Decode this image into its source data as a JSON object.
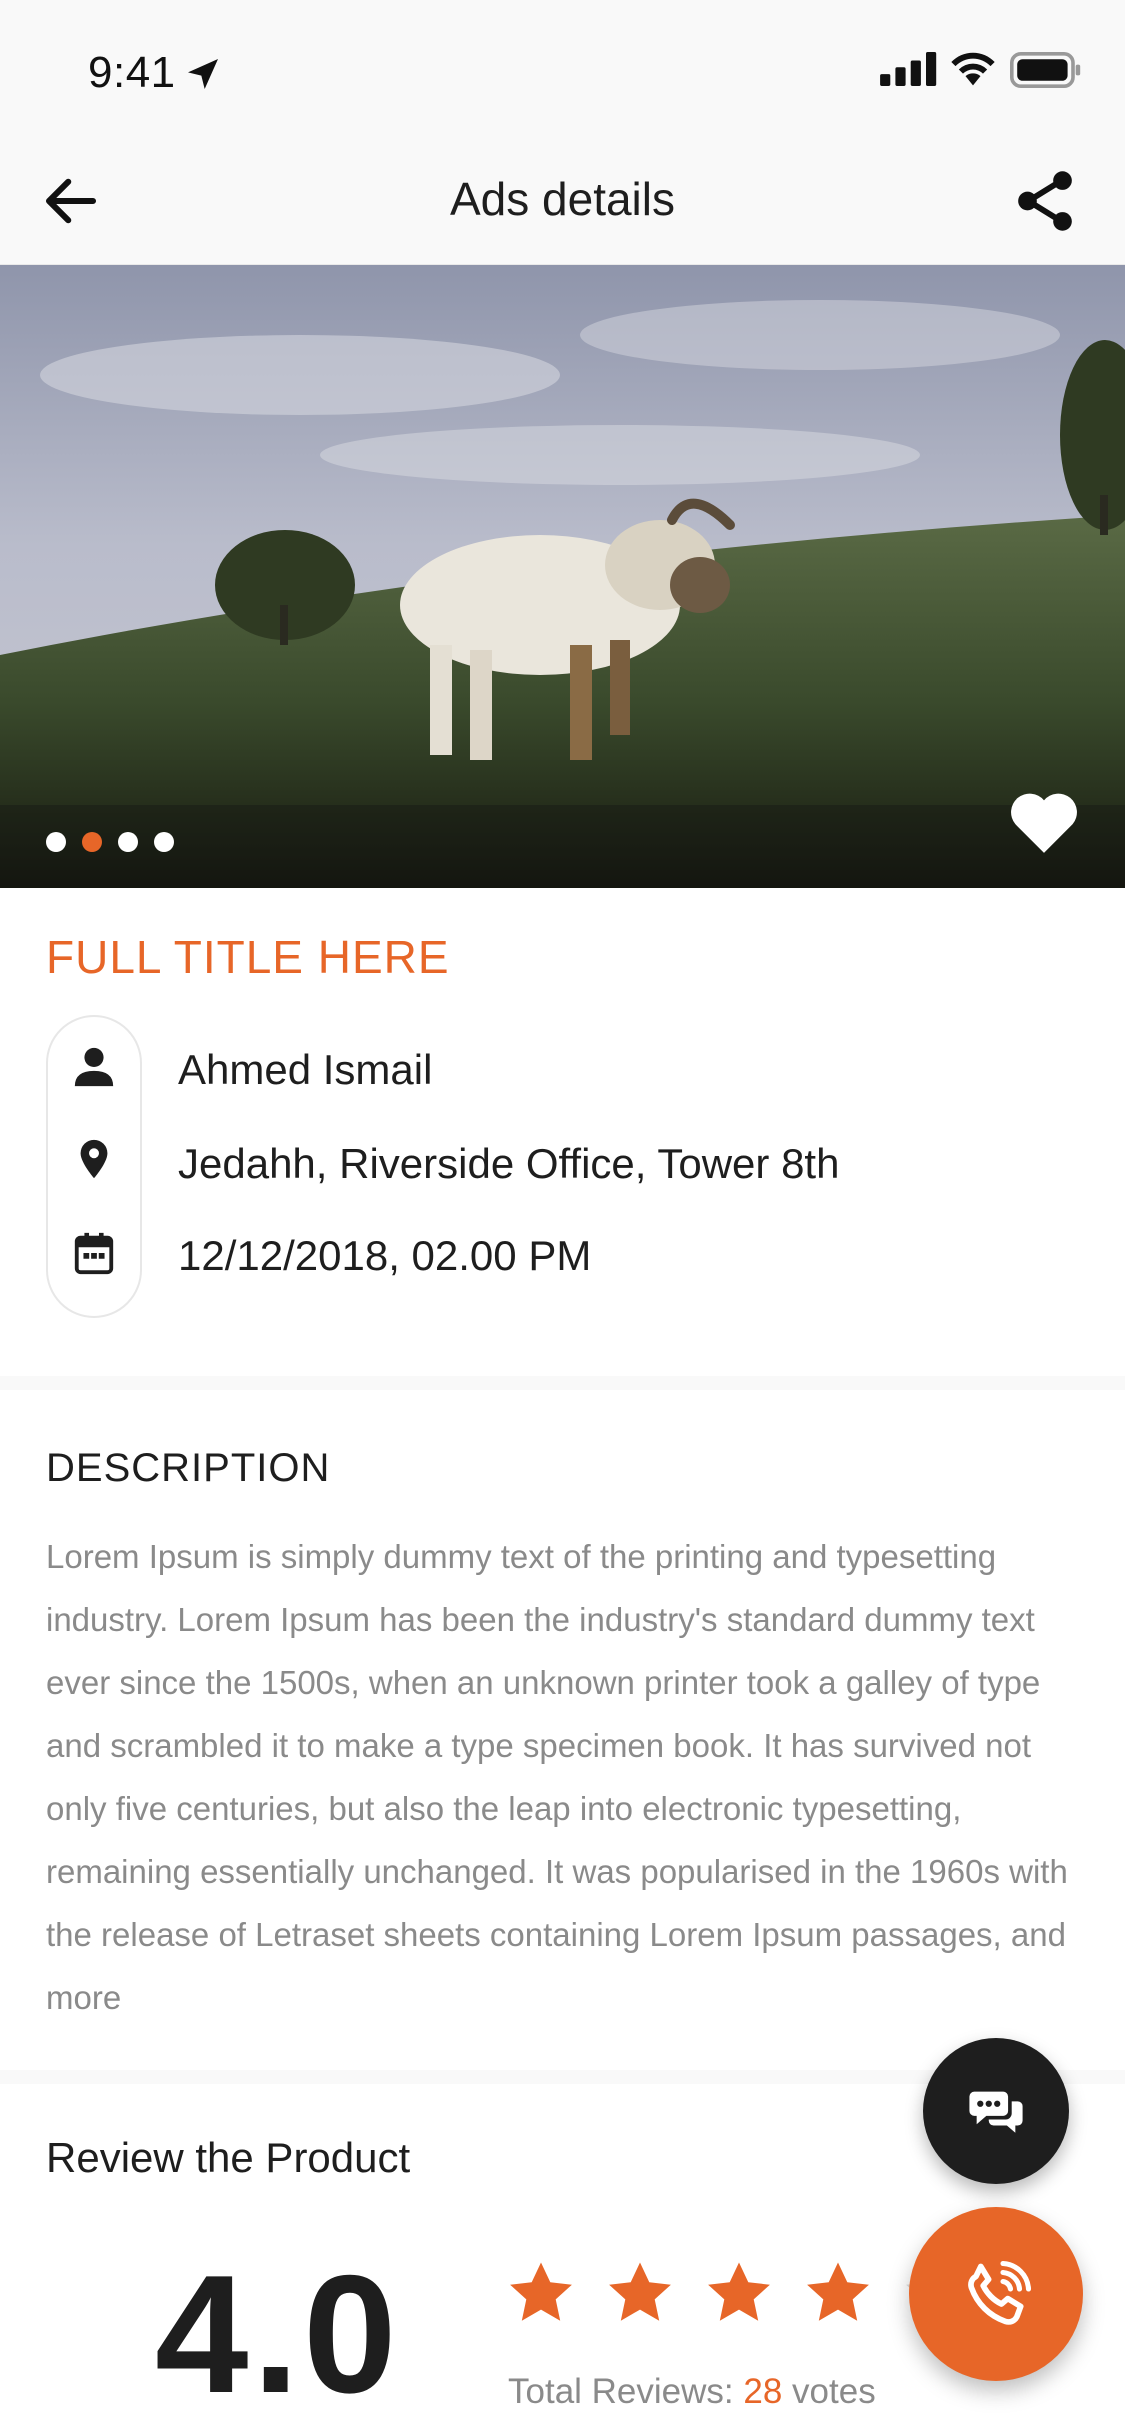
{
  "status_bar": {
    "time": "9:41"
  },
  "nav": {
    "title": "Ads details"
  },
  "gallery": {
    "image_count": 4,
    "active_index": 1
  },
  "ad": {
    "title": "FULL TITLE HERE",
    "seller": "Ahmed Ismail",
    "location": "Jedahh, Riverside Office, Tower 8th",
    "datetime": "12/12/2018, 02.00 PM"
  },
  "description": {
    "heading": "DESCRIPTION",
    "text": "Lorem Ipsum is simply dummy text of the printing and typesetting industry. Lorem Ipsum has been the industry's standard dummy text ever since the 1500s, when an unknown printer took a galley of type and scrambled it to make a type specimen book. It has survived not only five centuries, but also the leap into electronic typesetting, remaining essentially unchanged. It was popularised in the 1960s with the release of Letraset sheets containing Lorem Ipsum passages, and more"
  },
  "review": {
    "heading": "Review the Product",
    "rating": "4.0",
    "stars_filled": 4,
    "stars_total": 5,
    "total_label": "Total Reviews:",
    "total_count": "28",
    "votes_label": "votes"
  },
  "colors": {
    "accent": "#e76628",
    "dark": "#1e1e1e",
    "muted": "#8a8a8a",
    "bar": "#f9f9f9"
  },
  "icons": {
    "back": "arrow-left-icon",
    "share": "share-icon",
    "favorite": "heart-icon",
    "person": "person-icon",
    "location": "map-pin-icon",
    "calendar": "calendar-icon",
    "chat": "chat-icon",
    "call": "phone-icon"
  }
}
